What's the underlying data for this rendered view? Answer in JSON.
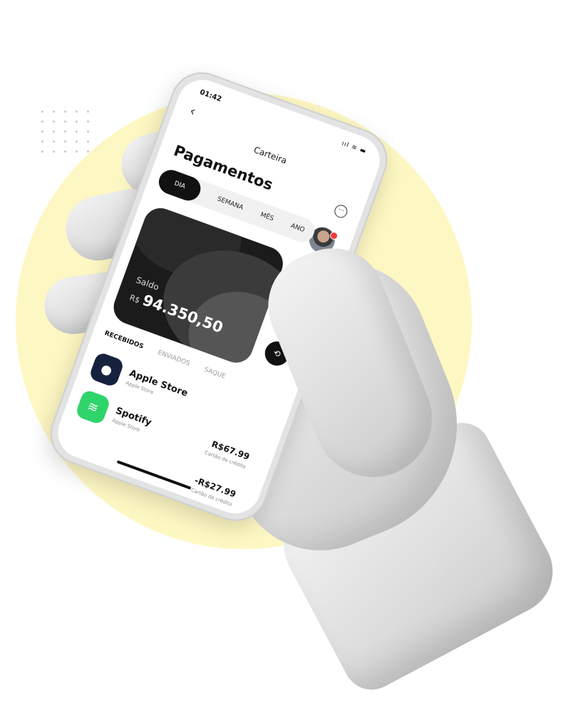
{
  "status": {
    "time": "01:42",
    "indicators": "ııl ≋ ▬"
  },
  "header": {
    "nav_title": "Carteira",
    "page_title": "Pagamentos",
    "back_glyph": "‹",
    "more_glyph": "···"
  },
  "period_filter": {
    "options": [
      "DIA",
      "SEMANA",
      "MÊS",
      "ANO"
    ],
    "selected": "DIA"
  },
  "balance_card": {
    "label": "Saldo",
    "currency": "R$",
    "amount": "94.350,50"
  },
  "actions": [
    {
      "icon": "transfer-icon",
      "glyph": "⇅"
    },
    {
      "icon": "add-card-icon",
      "glyph": "⊞"
    },
    {
      "icon": "exchange-icon",
      "glyph": "⟲"
    }
  ],
  "transaction_tabs": [
    "RECEBIDOS",
    "ENVIADOS",
    "SAQUE"
  ],
  "transactions": [
    {
      "name": "Apple Store",
      "subtitle": "Apple Store",
      "amount": "",
      "method": "",
      "icon": "apple-icon"
    },
    {
      "name": "Spotify",
      "subtitle": "Apple Store",
      "amount": "R$67.99",
      "method": "Cartão de crédito",
      "icon": "spotify-icon"
    },
    {
      "name": "",
      "subtitle": "",
      "amount": "-R$27.99",
      "method": "Cartão de crédito",
      "icon": ""
    }
  ],
  "colors": {
    "background_circle": "#fdf7c3",
    "card_dark": "#1b1b1b",
    "accent_red": "#ee3b3b",
    "spotify_green": "#2fd46a",
    "apple_navy": "#16213d"
  }
}
